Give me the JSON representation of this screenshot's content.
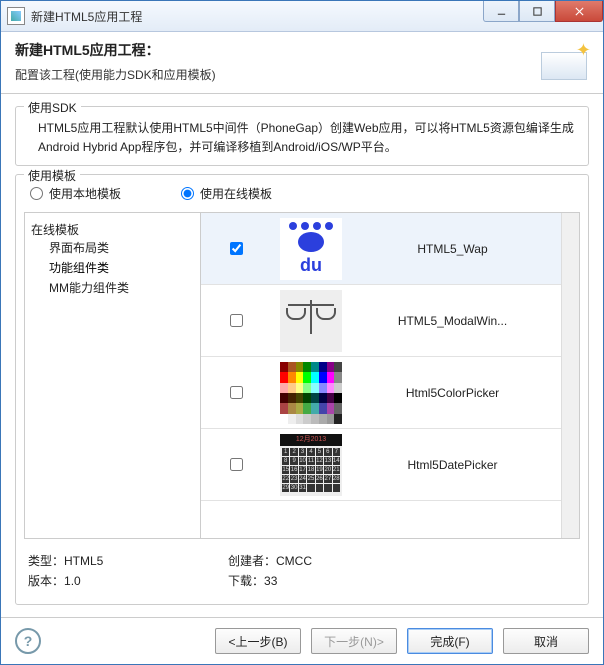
{
  "window": {
    "title": "新建HTML5应用工程"
  },
  "header": {
    "title": "新建HTML5应用工程：",
    "subtitle": "配置该工程(使用能力SDK和应用模板)"
  },
  "sdk": {
    "group_label": "使用SDK",
    "desc_line": "HTML5应用工程默认使用HTML5中间件（PhoneGap）创建Web应用，可以将HTML5资源包编译生成Android Hybrid App程序包，并可编译移植到Android/iOS/WP平台。"
  },
  "template": {
    "group_label": "使用模板",
    "radio_local": "使用本地模板",
    "radio_online": "使用在线模板",
    "tree": {
      "root": "在线模板",
      "children": [
        "界面布局类",
        "功能组件类",
        "MM能力组件类"
      ]
    },
    "rows": [
      {
        "name": "HTML5_Wap",
        "checked": true
      },
      {
        "name": "HTML5_ModalWin...",
        "checked": false
      },
      {
        "name": "Html5ColorPicker",
        "checked": false
      },
      {
        "name": "Html5DatePicker",
        "checked": false
      }
    ]
  },
  "meta": {
    "type_label": "类型：",
    "type_value": "HTML5",
    "creator_label": "创建者：",
    "creator_value": "CMCC",
    "version_label": "版本：",
    "version_value": "1.0",
    "downloads_label": "下载：",
    "downloads_value": "33"
  },
  "footer": {
    "back": "<上一步(B)",
    "next": "下一步(N)>",
    "finish": "完成(F)",
    "cancel": "取消"
  },
  "date_header": "12月2013"
}
